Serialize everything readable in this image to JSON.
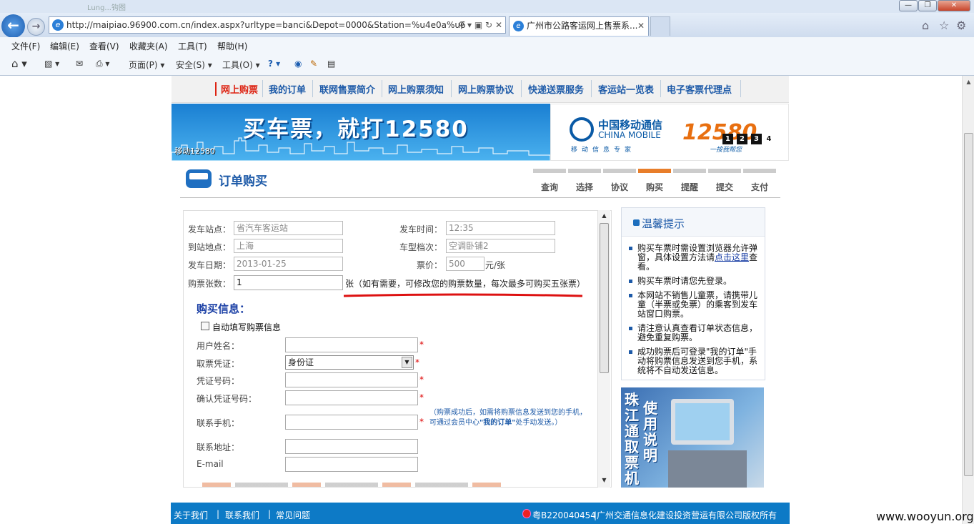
{
  "browser": {
    "window_title": "Lung...钩图",
    "address_url": "http://maipiao.96900.com.cn/index.aspx?urltype=banci&Depot=0000&Station=%u4e0a%u6",
    "tab_title": "广州市公路客运网上售票系...",
    "menu": [
      "文件(F)",
      "编辑(E)",
      "查看(V)",
      "收藏夹(A)",
      "工具(T)",
      "帮助(H)"
    ],
    "cmd": {
      "page": "页面(P)",
      "safety": "安全(S)",
      "tools": "工具(O)"
    }
  },
  "site": {
    "nav": [
      "网上购票",
      "我的订单",
      "联网售票简介",
      "网上购票须知",
      "网上购票协议",
      "快递送票服务",
      "客运站一览表",
      "电子客票代理点"
    ],
    "banner": {
      "slogan": "买车票，就打12580",
      "caption": "移动12580"
    },
    "brand": {
      "cn": "中国移动通信",
      "en": "CHINA MOBILE",
      "sub": "移动信息专家",
      "num": "12580",
      "tagline": "一按我帮您",
      "slides": [
        "1",
        "2",
        "3",
        "4"
      ]
    },
    "order_title": "订单购买",
    "steps": [
      "查询",
      "选择",
      "协议",
      "购买",
      "提醒",
      "提交",
      "支付"
    ],
    "active_step": "购买"
  },
  "form": {
    "depart_station_label": "发车站点：",
    "depart_station": "省汽车客运站",
    "depart_time_label": "发车时间：",
    "depart_time": "12:35",
    "arrive_label": "到站地点：",
    "arrive": "上海",
    "vehicle_label": "车型档次：",
    "vehicle": "空调卧铺2",
    "date_label": "发车日期：",
    "date": "2013-01-25",
    "price_label": "票价：",
    "price": "500",
    "price_unit": "元/张",
    "count_label": "购票张数：",
    "count": "1",
    "count_note": "张（如有需要，可修改您的购票数量，每次最多可购买五张票）",
    "buy_info_title": "购买信息：",
    "autofill": "自动填写购票信息",
    "user_name_label": "用户姓名：",
    "id_type_label": "取票凭证：",
    "id_type": "身份证",
    "id_no_label": "凭证号码：",
    "id_confirm_label": "确认凭证号码：",
    "phone_label": "联系手机：",
    "phone_note": "（购票成功后，如需将购票信息发送到您的手机，可通过会员中心",
    "phone_note_bold": "\"我的订单\"",
    "phone_note_end": "处手动发送。）",
    "address_label": "联系地址：",
    "email_label": "E-mail",
    "star": "*"
  },
  "tips": {
    "title": "温馨提示",
    "items": [
      {
        "text": "购买车票时需设置浏览器允许弹窗，具体设置方法请",
        "link": "点击这里",
        "after": "查看。"
      },
      {
        "text": "购买车票时请您先登录。"
      },
      {
        "text": "本网站不销售儿童票，请携带儿童（半票或免票）的乘客到发车站窗口购票。"
      },
      {
        "text": "请注意认真查看订单状态信息，避免重复购票。"
      },
      {
        "text": "成功购票后可登录\"我的订单\"手动将购票信息发送到您手机，系统将不自动发送信息。"
      }
    ]
  },
  "kiosk": {
    "col1": [
      "珠",
      "江",
      "通",
      "取",
      "票",
      "机"
    ],
    "col2": [
      "使",
      "用",
      "说",
      "明"
    ]
  },
  "footer": {
    "links": [
      "关于我们",
      "|",
      "联系我们",
      "|",
      "常见问题"
    ],
    "license": "粤B220040454",
    "copyright": "广州交通信息化建设投资营运有限公司版权所有"
  },
  "watermark": "www.wooyun.org"
}
